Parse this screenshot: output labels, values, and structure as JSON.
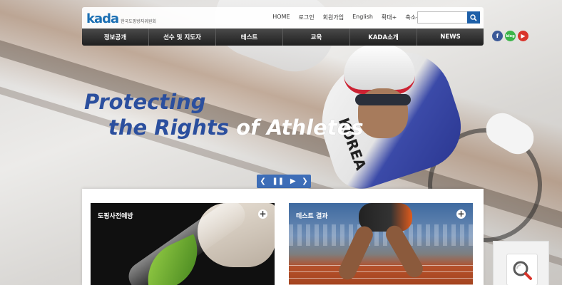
{
  "header": {
    "logo_text": "kada",
    "logo_sub": "한국도핑방지위원회",
    "util_links": [
      "HOME",
      "로그인",
      "회원가입",
      "English",
      "확대+",
      "축소-"
    ],
    "search": {
      "placeholder": ""
    }
  },
  "nav": {
    "items": [
      "정보공개",
      "선수 및 지도자",
      "테스트",
      "교육",
      "KADA소개",
      "NEWS"
    ]
  },
  "social": [
    "facebook-icon",
    "blog-icon",
    "youtube-icon"
  ],
  "hero": {
    "line1": "Protecting",
    "line2_a": "the Rights ",
    "line2_b": "of",
    "line2_c": " Athletes",
    "rider_text": "KOREA"
  },
  "slider": {
    "prev": "❮",
    "pause": "❚❚",
    "play": "▶",
    "next": "❯"
  },
  "cards": [
    {
      "title": "도핑사전예방",
      "more": "+"
    },
    {
      "title": "테스트 결과",
      "more": "+"
    }
  ],
  "colors": {
    "brand_blue": "#1d5fa8",
    "headline_blue": "#2b4f9e",
    "nav_dark": "#2a2a2a",
    "slider_blue": "#3d6db7"
  }
}
